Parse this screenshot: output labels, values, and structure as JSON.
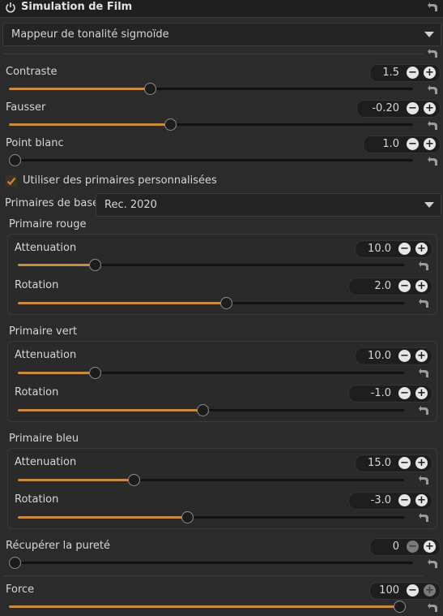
{
  "module": {
    "title": "Simulation de Film"
  },
  "mapper": {
    "selected": "Mappeur de tonalité sigmoïde"
  },
  "sliders": {
    "contrast": {
      "label": "Contraste",
      "value": "1.5",
      "fraction": 0.35
    },
    "skew": {
      "label": "Fausser",
      "value": "-0.20",
      "fraction": 0.4
    },
    "white_point": {
      "label": "Point blanc",
      "value": "1.0",
      "fraction": 0.0
    }
  },
  "custom_primaries": {
    "label": "Utiliser des primaires personnalisées",
    "checked": true
  },
  "base_primaries": {
    "label": "Primaires de base:",
    "selected": "Rec. 2020"
  },
  "groups": [
    {
      "title": "Primaire rouge",
      "attenuation": {
        "label": "Attenuation",
        "value": "10.0",
        "fraction": 0.2
      },
      "rotation": {
        "label": "Rotation",
        "value": "2.0",
        "fraction": 0.54
      }
    },
    {
      "title": "Primaire vert",
      "attenuation": {
        "label": "Attenuation",
        "value": "10.0",
        "fraction": 0.2
      },
      "rotation": {
        "label": "Rotation",
        "value": "-1.0",
        "fraction": 0.48
      }
    },
    {
      "title": "Primaire bleu",
      "attenuation": {
        "label": "Attenuation",
        "value": "15.0",
        "fraction": 0.3
      },
      "rotation": {
        "label": "Rotation",
        "value": "-3.0",
        "fraction": 0.44
      }
    }
  ],
  "purity": {
    "label": "Récupérer la pureté",
    "value": "0",
    "fraction": 0.0
  },
  "force": {
    "label": "Force",
    "value": "100",
    "fraction": 1.0
  },
  "glyphs": {
    "minus": "−",
    "plus": "+"
  },
  "colors": {
    "accent": "#c9893e",
    "checkbox": "#d08a34"
  }
}
